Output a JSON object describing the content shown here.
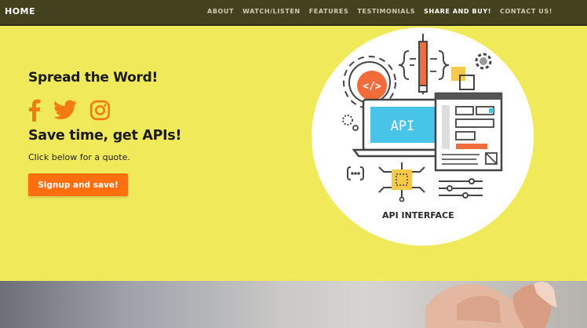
{
  "nav": {
    "brand": "HOME",
    "items": [
      "ABOUT",
      "WATCH/LISTEN",
      "FEATURES",
      "TESTIMONIALS",
      "SHARE AND BUY!",
      "CONTACT US!"
    ],
    "active": "SHARE AND BUY!"
  },
  "hero": {
    "title": "Spread the Word!",
    "social_icons": [
      "facebook-icon",
      "twitter-icon",
      "instagram-icon"
    ],
    "subtitle": "Save time, get APIs!",
    "description": "Click below for a quote.",
    "cta_label": "Signup and save!",
    "illustration": {
      "screen_text": "API",
      "code_text": "</>",
      "caption": "API INTERFACE"
    }
  },
  "colors": {
    "background": "#f0e95a",
    "navbar": "#44411e",
    "accent": "#f37b14",
    "button": "#ff6f0f"
  }
}
